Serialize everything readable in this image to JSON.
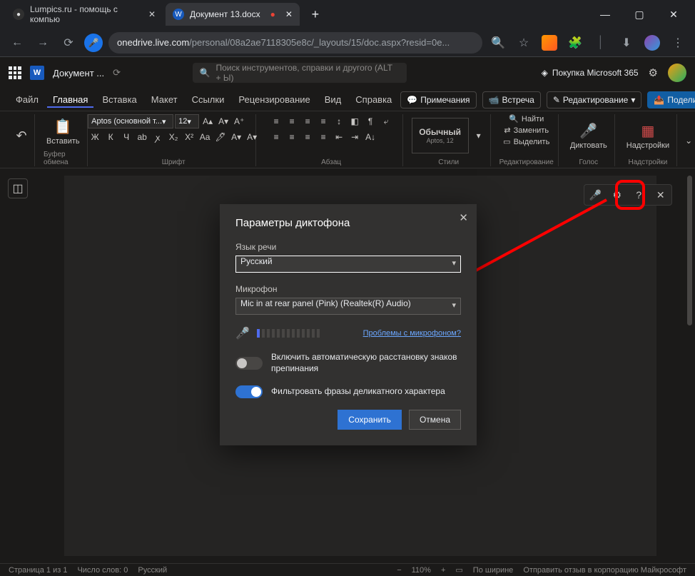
{
  "browser": {
    "tabs": [
      {
        "title": "Lumpics.ru - помощь с компью",
        "favicon": "●"
      },
      {
        "title": "Документ 13.docx",
        "favicon": "W",
        "recording": "●"
      }
    ],
    "win": {
      "min": "—",
      "max": "▢",
      "close": "✕"
    },
    "nav": {
      "back": "←",
      "fwd": "→",
      "reload": "⟳"
    },
    "url_host": "onedrive.live.com",
    "url_path": "/personal/08a2ae7118305e8c/_layouts/15/doc.aspx?resid=0e...",
    "icons": {
      "search": "🔍",
      "star": "☆",
      "ext": "🧩",
      "dl": "⬇",
      "menu": "⋮"
    }
  },
  "word_header": {
    "logo": "W",
    "doc_name": "Документ ...",
    "saved_icon": "⟳",
    "search_placeholder": "Поиск инструментов, справки и другого (ALT + Ы)",
    "premium_label": "Покупка Microsoft 365",
    "premium_icon": "◈"
  },
  "ribbon_tabs": {
    "items": [
      "Файл",
      "Главная",
      "Вставка",
      "Макет",
      "Ссылки",
      "Рецензирование",
      "Вид",
      "Справка"
    ],
    "active_index": 1,
    "right": {
      "comments": "Примечания",
      "meet": "Встреча",
      "editing": "Редактирование",
      "share": "Поделиться"
    }
  },
  "ribbon": {
    "undo": "↶",
    "clipboard": {
      "paste": "Вставить",
      "icon": "📋",
      "group": "Буфер обмена"
    },
    "font": {
      "name": "Aptos (основной т...",
      "size": "12",
      "group": "Шрифт",
      "btns_row1": [
        "A▴",
        "A▾",
        "A⁺"
      ],
      "btns_row2": [
        "Ж",
        "К",
        "Ч",
        "ab",
        "ꭗ",
        "X₂",
        "X²",
        "Aa",
        "🖊",
        "A▾",
        "A▾"
      ]
    },
    "para": {
      "group": "Абзац",
      "row1": [
        "≡",
        "≡",
        "≡",
        "≡",
        "↕",
        "◧",
        "¶",
        "⤶"
      ],
      "row2": [
        "≡",
        "≡",
        "≡",
        "≡",
        "⇤",
        "⇥",
        "A↓"
      ]
    },
    "styles": {
      "name": "Обычный",
      "sub": "Aptos, 12",
      "group": "Стили"
    },
    "editing": {
      "find": "Найти",
      "replace": "Заменить",
      "select": "Выделить",
      "group": "Редактирование"
    },
    "dictate": {
      "label": "Диктовать",
      "group": "Голос"
    },
    "addins": {
      "label": "Надстройки",
      "group": "Надстройки"
    }
  },
  "dict_toolbar": {
    "mic": "🎤",
    "gear": "⚙",
    "help": "?",
    "close": "✕"
  },
  "dialog": {
    "title": "Параметры диктофона",
    "close": "✕",
    "lang_label": "Язык речи",
    "lang_value": "Русский",
    "mic_label": "Микрофон",
    "mic_value": "Mic in at rear panel (Pink) (Realtek(R) Audio)",
    "mic_icon": "🎤",
    "mic_help": "Проблемы с микрофоном?",
    "auto_punct": "Включить автоматическую расстановку знаков препинания",
    "filter": "Фильтровать фразы деликатного характера",
    "save": "Сохранить",
    "cancel": "Отмена"
  },
  "status": {
    "page": "Страница 1 из 1",
    "words": "Число слов: 0",
    "lang": "Русский",
    "zoom": "110%",
    "fit": "По ширине",
    "feedback": "Отправить отзыв в корпорацию Майкрософт"
  },
  "annotation": {
    "arrow_color": "#ff0000"
  }
}
